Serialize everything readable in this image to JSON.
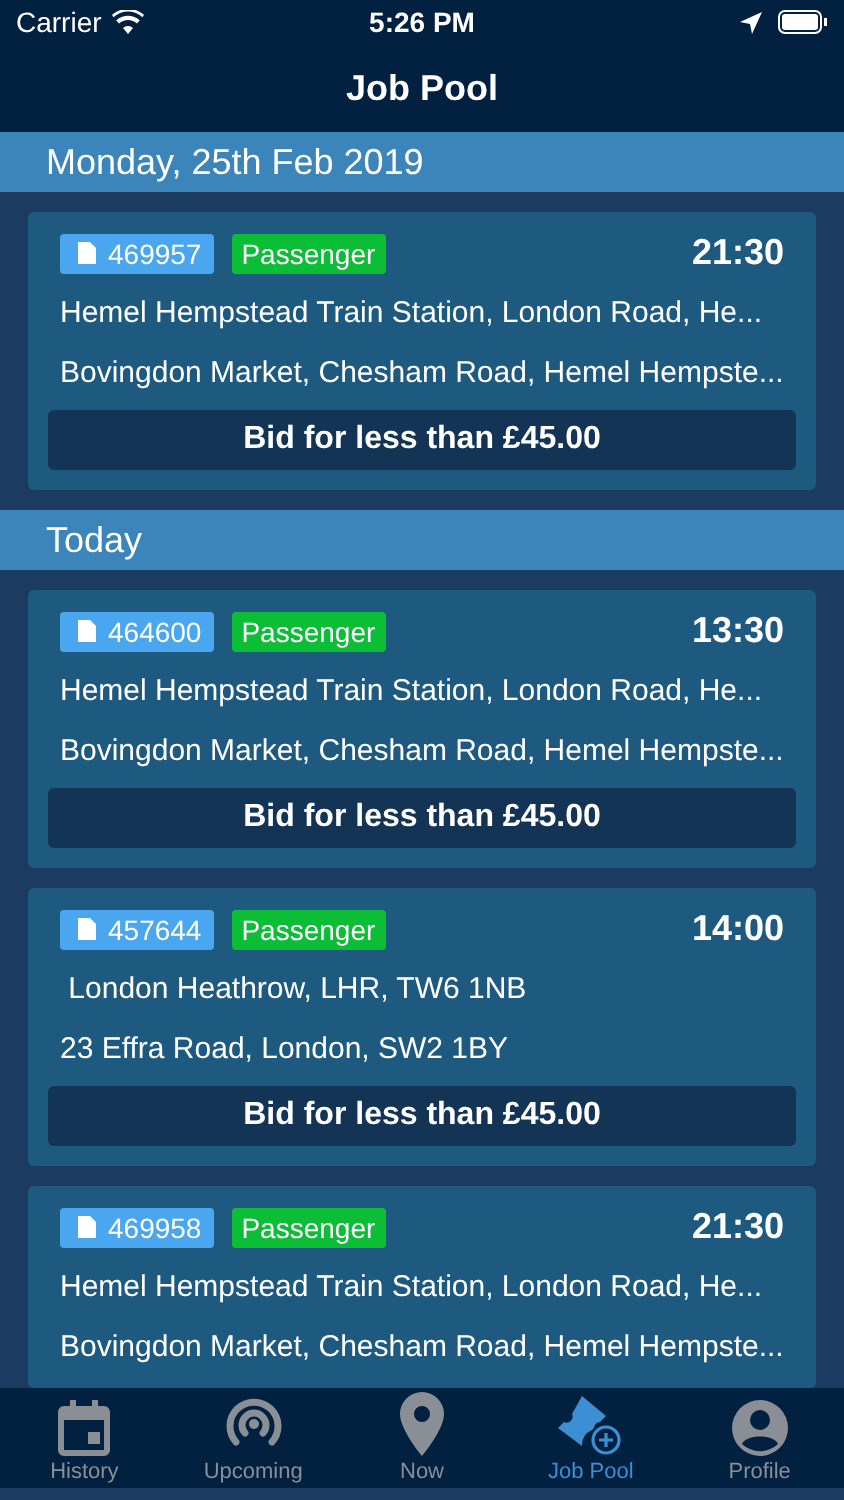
{
  "status_bar": {
    "carrier": "Carrier",
    "time": "5:26 PM"
  },
  "nav": {
    "title": "Job Pool"
  },
  "sections": [
    {
      "title": "Monday, 25th Feb 2019",
      "jobs": [
        {
          "id": "469957",
          "type": "Passenger",
          "time": "21:30",
          "pickup": "Hemel Hempstead Train Station, London Road, He...",
          "dropoff": "Bovingdon Market, Chesham Road, Hemel Hempste...",
          "bid": "Bid for less than £45.00"
        }
      ]
    },
    {
      "title": "Today",
      "jobs": [
        {
          "id": "464600",
          "type": "Passenger",
          "time": "13:30",
          "pickup": "Hemel Hempstead Train Station, London Road, He...",
          "dropoff": "Bovingdon Market, Chesham Road, Hemel Hempste...",
          "bid": "Bid for less than £45.00"
        },
        {
          "id": "457644",
          "type": "Passenger",
          "time": "14:00",
          "pickup": " London Heathrow, LHR, TW6 1NB",
          "dropoff": "23 Effra Road, London, SW2 1BY",
          "bid": "Bid for less than £45.00"
        },
        {
          "id": "469958",
          "type": "Passenger",
          "time": "21:30",
          "pickup": "Hemel Hempstead Train Station, London Road, He...",
          "dropoff": "Bovingdon Market, Chesham Road, Hemel Hempste..."
        }
      ]
    }
  ],
  "tab_bar": [
    {
      "kind": "calendar",
      "label": "History",
      "selected": false
    },
    {
      "kind": "signal",
      "label": "Upcoming",
      "selected": false
    },
    {
      "kind": "pin",
      "label": "Now",
      "selected": false
    },
    {
      "kind": "ticket",
      "label": "Job Pool",
      "selected": true
    },
    {
      "kind": "person",
      "label": "Profile",
      "selected": false
    }
  ]
}
